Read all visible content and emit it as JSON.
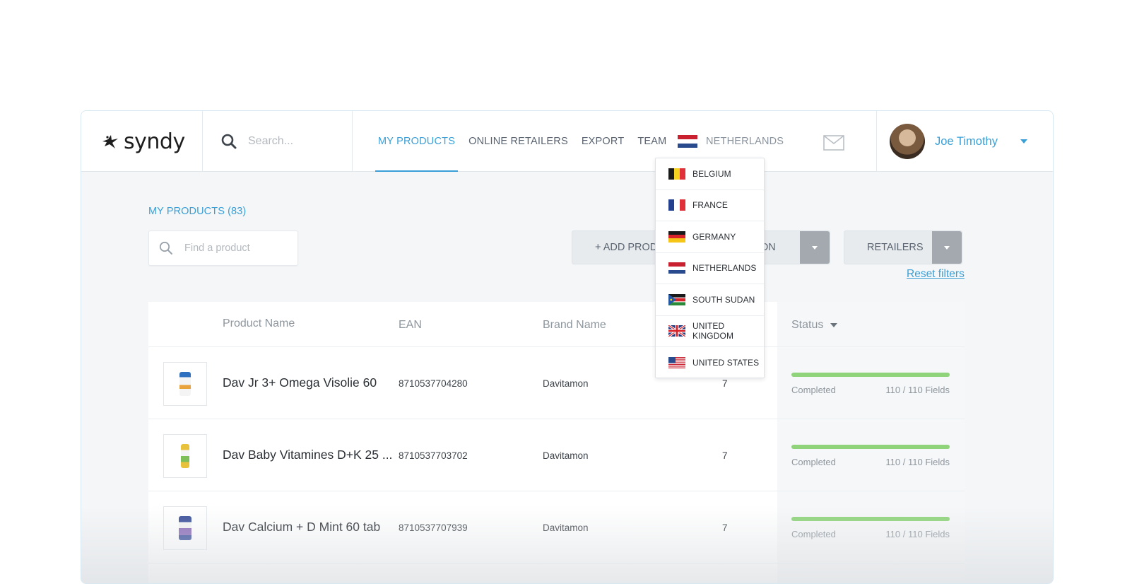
{
  "header": {
    "logo_text": "syndy",
    "search_placeholder": "Search...",
    "nav": [
      {
        "label": "MY PRODUCTS",
        "active": true
      },
      {
        "label": "ONLINE RETAILERS",
        "active": false
      },
      {
        "label": "EXPORT",
        "active": false
      },
      {
        "label": "TEAM",
        "active": false
      }
    ],
    "country": {
      "label": "NETHERLANDS",
      "flag": "netherlands-flag-icon"
    },
    "user": {
      "name": "Joe Timothy"
    }
  },
  "content": {
    "title": "MY PRODUCTS (83)",
    "find_placeholder": "Find a product",
    "add_button": "+ ADD PRODUC",
    "add_button_tail": "ON",
    "retailers_button": "RETAILERS",
    "reset_filters": "Reset filters"
  },
  "table": {
    "columns": [
      "Product Name",
      "EAN",
      "Brand Name",
      "Status"
    ],
    "rows": [
      {
        "name": "Dav Jr 3+ Omega Visolie 60",
        "ean": "8710537704280",
        "brand": "Davitamon",
        "count": "7",
        "status": "Completed",
        "fields": "110 / 110 Fields",
        "progress": 1.0
      },
      {
        "name": "Dav Baby Vitamines D+K 25 ...",
        "ean": "8710537703702",
        "brand": "Davitamon",
        "count": "7",
        "status": "Completed",
        "fields": "110 / 110 Fields",
        "progress": 1.0
      },
      {
        "name": "Dav Calcium + D Mint 60 tab",
        "ean": "8710537707939",
        "brand": "Davitamon",
        "count": "7",
        "status": "Completed",
        "fields": "110 / 110 Fields",
        "progress": 1.0
      }
    ]
  },
  "country_dropdown": {
    "items": [
      {
        "label": "BELGIUM",
        "icon": "belgium-flag-icon"
      },
      {
        "label": "FRANCE",
        "icon": "france-flag-icon"
      },
      {
        "label": "GERMANY",
        "icon": "germany-flag-icon"
      },
      {
        "label": "NETHERLANDS",
        "icon": "netherlands-flag-icon"
      },
      {
        "label": "SOUTH SUDAN",
        "icon": "south-sudan-flag-icon"
      },
      {
        "label": "UNITED KINGDOM",
        "icon": "united-kingdom-flag-icon"
      },
      {
        "label": "UNITED STATES",
        "icon": "united-states-flag-icon"
      }
    ]
  },
  "colors": {
    "accent": "#3a9fd6",
    "progress": "#8fd47a",
    "button_bg": "#e8ebee",
    "dropdown_toggle": "#a3a9ae"
  }
}
